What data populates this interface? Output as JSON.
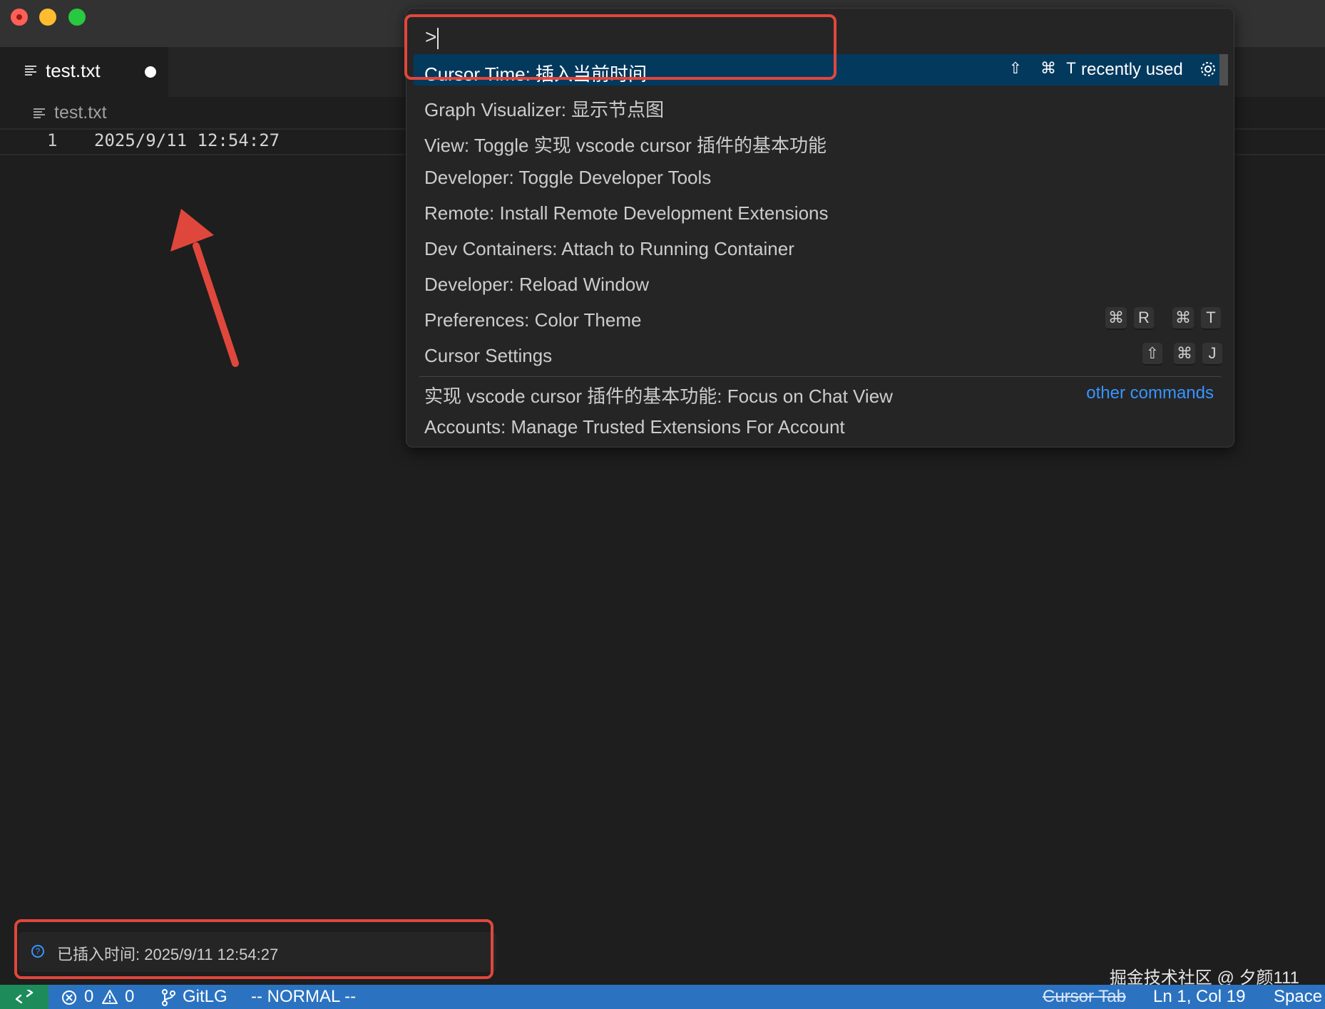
{
  "tab": {
    "label": "test.txt"
  },
  "breadcrumb": {
    "label": "test.txt"
  },
  "editor": {
    "line_number": "1",
    "line_text": "2025/9/11 12:54:27"
  },
  "palette": {
    "input_value": ">",
    "items": [
      {
        "label": "Cursor Time: 插入当前时间",
        "keys": [
          "⇧",
          "⌘",
          "T"
        ],
        "badge": "recently used"
      },
      {
        "label": "Graph Visualizer: 显示节点图"
      },
      {
        "label": "View: Toggle 实现 vscode cursor 插件的基本功能"
      },
      {
        "label": "Developer: Toggle Developer Tools"
      },
      {
        "label": "Remote: Install Remote Development Extensions"
      },
      {
        "label": "Dev Containers: Attach to Running Container"
      },
      {
        "label": "Developer: Reload Window"
      },
      {
        "label": "Preferences: Color Theme",
        "keys": [
          "⌘",
          "R",
          "⌘",
          "T"
        ]
      },
      {
        "label": "Cursor Settings",
        "keys": [
          "⇧",
          "⌘",
          "J"
        ]
      },
      {
        "label": "实现 vscode cursor 插件的基本功能: Focus on Chat View",
        "badge": "other commands"
      },
      {
        "label": "Accounts: Manage Trusted Extensions For Account"
      }
    ]
  },
  "notification": {
    "text": "已插入时间: 2025/9/11 12:54:27"
  },
  "watermark": "掘金技术社区 @ 夕颜111",
  "statusbar": {
    "errors": "0",
    "warnings": "0",
    "git": "GitLG",
    "mode": "-- NORMAL --",
    "cursor_tab": "Cursor Tab",
    "position": "Ln 1, Col 19",
    "spaces": "Space"
  }
}
